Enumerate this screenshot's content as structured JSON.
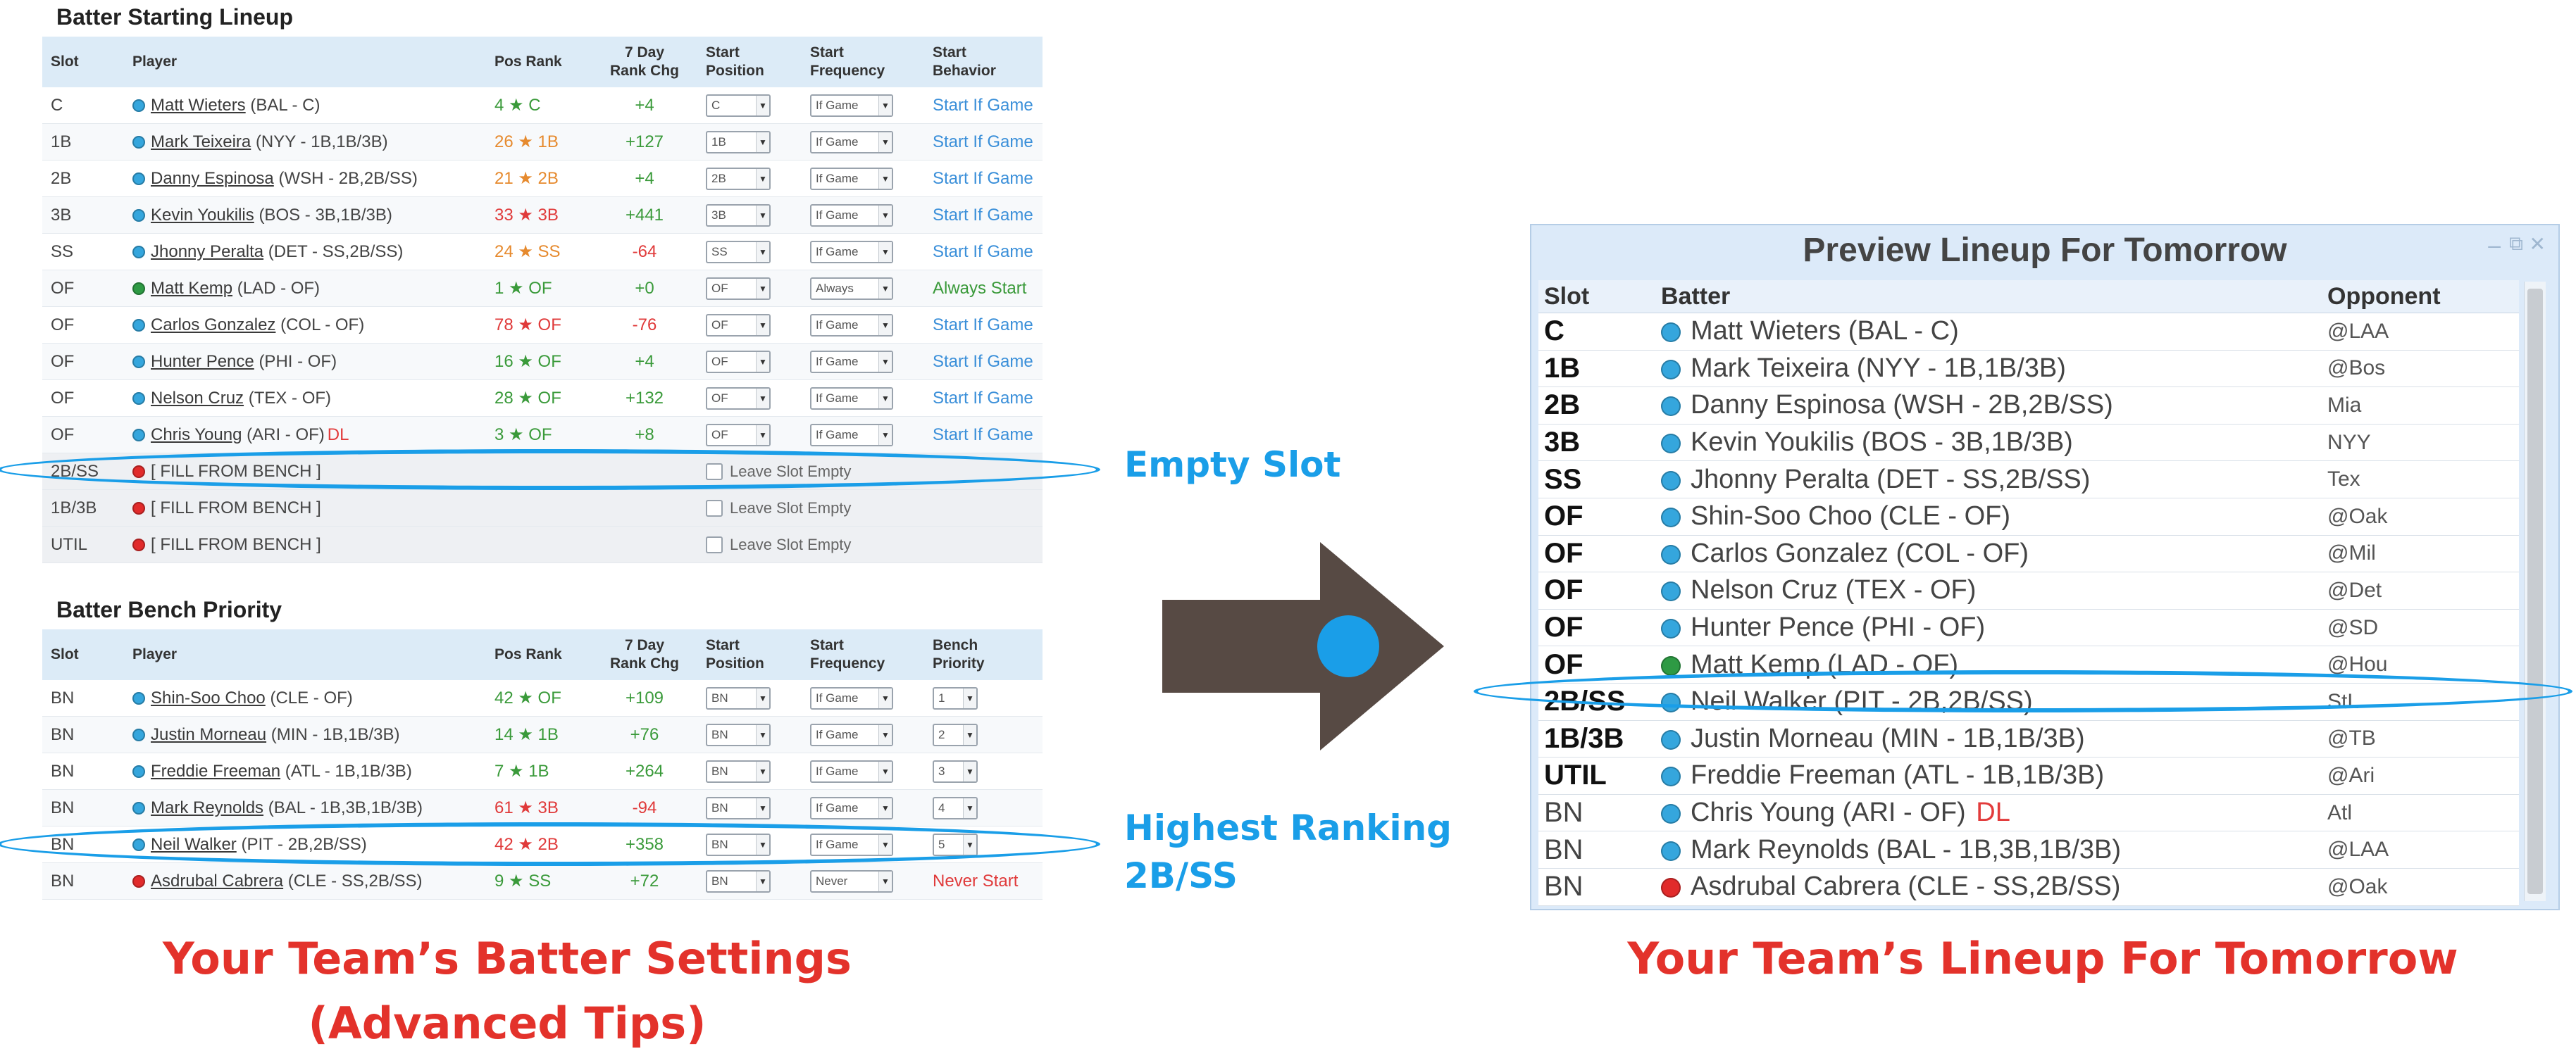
{
  "colors": {
    "accent_blue": "#1a9ee8",
    "caption_red": "#e3322b",
    "arrow": "#574a44",
    "player_blue": "#35a6dd",
    "player_green": "#2e9a44",
    "player_red": "#e12b2b"
  },
  "starting": {
    "title": "Batter Starting Lineup",
    "headers": {
      "slot": "Slot",
      "player": "Player",
      "pos_rank": "Pos Rank",
      "chg_line1": "7 Day",
      "chg_line2": "Rank Chg",
      "pos_line1": "Start",
      "pos_line2": "Position",
      "freq_line1": "Start",
      "freq_line2": "Frequency",
      "beh_line1": "Start",
      "beh_line2": "Behavior"
    },
    "rows": [
      {
        "slot": "C",
        "player": "Matt Wieters",
        "info": "(BAL - C)",
        "dot": "blue",
        "rank": "4 ★ C",
        "rank_color": "#3a9a3a",
        "chg": "+4",
        "chg_color": "#3a9a3a",
        "pos": "C",
        "freq": "If Game",
        "behavior": "Start If Game",
        "behavior_color": "#3a8fd9"
      },
      {
        "slot": "1B",
        "player": "Mark Teixeira",
        "info": "(NYY - 1B,1B/3B)",
        "dot": "blue",
        "rank": "26 ★ 1B",
        "rank_color": "#e68a2e",
        "chg": "+127",
        "chg_color": "#3a9a3a",
        "pos": "1B",
        "freq": "If Game",
        "behavior": "Start If Game",
        "behavior_color": "#3a8fd9"
      },
      {
        "slot": "2B",
        "player": "Danny Espinosa",
        "info": "(WSH - 2B,2B/SS)",
        "dot": "blue",
        "rank": "21 ★ 2B",
        "rank_color": "#e68a2e",
        "chg": "+4",
        "chg_color": "#3a9a3a",
        "pos": "2B",
        "freq": "If Game",
        "behavior": "Start If Game",
        "behavior_color": "#3a8fd9"
      },
      {
        "slot": "3B",
        "player": "Kevin Youkilis",
        "info": "(BOS - 3B,1B/3B)",
        "dot": "blue",
        "rank": "33 ★ 3B",
        "rank_color": "#e03a3a",
        "chg": "+441",
        "chg_color": "#3a9a3a",
        "pos": "3B",
        "freq": "If Game",
        "behavior": "Start If Game",
        "behavior_color": "#3a8fd9"
      },
      {
        "slot": "SS",
        "player": "Jhonny Peralta",
        "info": "(DET - SS,2B/SS)",
        "dot": "blue",
        "rank": "24 ★ SS",
        "rank_color": "#e68a2e",
        "chg": "-64",
        "chg_color": "#e03a3a",
        "pos": "SS",
        "freq": "If Game",
        "behavior": "Start If Game",
        "behavior_color": "#3a8fd9"
      },
      {
        "slot": "OF",
        "player": "Matt Kemp",
        "info": "(LAD - OF)",
        "dot": "green",
        "rank": "1 ★ OF",
        "rank_color": "#3a9a3a",
        "chg": "+0",
        "chg_color": "#3a9a3a",
        "pos": "OF",
        "freq": "Always",
        "behavior": "Always Start",
        "behavior_color": "#3a9a3a"
      },
      {
        "slot": "OF",
        "player": "Carlos Gonzalez",
        "info": "(COL - OF)",
        "dot": "blue",
        "rank": "78 ★ OF",
        "rank_color": "#e03a3a",
        "chg": "-76",
        "chg_color": "#e03a3a",
        "pos": "OF",
        "freq": "If Game",
        "behavior": "Start If Game",
        "behavior_color": "#3a8fd9"
      },
      {
        "slot": "OF",
        "player": "Hunter Pence",
        "info": "(PHI - OF)",
        "dot": "blue",
        "rank": "16 ★ OF",
        "rank_color": "#3a9a3a",
        "chg": "+4",
        "chg_color": "#3a9a3a",
        "pos": "OF",
        "freq": "If Game",
        "behavior": "Start If Game",
        "behavior_color": "#3a8fd9"
      },
      {
        "slot": "OF",
        "player": "Nelson Cruz",
        "info": "(TEX - OF)",
        "dot": "blue",
        "rank": "28 ★ OF",
        "rank_color": "#3a9a3a",
        "chg": "+132",
        "chg_color": "#3a9a3a",
        "pos": "OF",
        "freq": "If Game",
        "behavior": "Start If Game",
        "behavior_color": "#3a8fd9"
      },
      {
        "slot": "OF",
        "player": "Chris Young",
        "info": "(ARI - OF)",
        "dl": "DL",
        "dot": "blue",
        "rank": "3 ★ OF",
        "rank_color": "#3a9a3a",
        "chg": "+8",
        "chg_color": "#3a9a3a",
        "pos": "OF",
        "freq": "If Game",
        "behavior": "Start If Game",
        "behavior_color": "#3a8fd9"
      }
    ],
    "fill_rows": [
      {
        "slot": "2B/SS",
        "text": "[ FILL FROM BENCH ]",
        "leave": "Leave Slot Empty"
      },
      {
        "slot": "1B/3B",
        "text": "[ FILL FROM BENCH ]",
        "leave": "Leave Slot Empty"
      },
      {
        "slot": "UTIL",
        "text": "[ FILL FROM BENCH ]",
        "leave": "Leave Slot Empty"
      }
    ]
  },
  "bench": {
    "title": "Batter Bench Priority",
    "headers": {
      "slot": "Slot",
      "player": "Player",
      "pos_rank": "Pos Rank",
      "chg_line1": "7 Day",
      "chg_line2": "Rank Chg",
      "pos_line1": "Start",
      "pos_line2": "Position",
      "freq_line1": "Start",
      "freq_line2": "Frequency",
      "pri_line1": "Bench",
      "pri_line2": "Priority"
    },
    "rows": [
      {
        "slot": "BN",
        "player": "Shin-Soo Choo",
        "info": "(CLE - OF)",
        "dot": "blue",
        "rank": "42 ★ OF",
        "rank_color": "#3a9a3a",
        "chg": "+109",
        "chg_color": "#3a9a3a",
        "pos": "BN",
        "freq": "If Game",
        "priority": "1"
      },
      {
        "slot": "BN",
        "player": "Justin Morneau",
        "info": "(MIN - 1B,1B/3B)",
        "dot": "blue",
        "rank": "14 ★ 1B",
        "rank_color": "#3a9a3a",
        "chg": "+76",
        "chg_color": "#3a9a3a",
        "pos": "BN",
        "freq": "If Game",
        "priority": "2"
      },
      {
        "slot": "BN",
        "player": "Freddie Freeman",
        "info": "(ATL - 1B,1B/3B)",
        "dot": "blue",
        "rank": "7 ★ 1B",
        "rank_color": "#3a9a3a",
        "chg": "+264",
        "chg_color": "#3a9a3a",
        "pos": "BN",
        "freq": "If Game",
        "priority": "3"
      },
      {
        "slot": "BN",
        "player": "Mark Reynolds",
        "info": "(BAL - 1B,3B,1B/3B)",
        "dot": "blue",
        "rank": "61 ★ 3B",
        "rank_color": "#e03a3a",
        "chg": "-94",
        "chg_color": "#e03a3a",
        "pos": "BN",
        "freq": "If Game",
        "priority": "4"
      },
      {
        "slot": "BN",
        "player": "Neil Walker",
        "info": "(PIT - 2B,2B/SS)",
        "dot": "blue",
        "rank": "42 ★ 2B",
        "rank_color": "#e03a3a",
        "chg": "+358",
        "chg_color": "#3a9a3a",
        "pos": "BN",
        "freq": "If Game",
        "priority": "5"
      },
      {
        "slot": "BN",
        "player": "Asdrubal Cabrera",
        "info": "(CLE - SS,2B/SS)",
        "dot": "red",
        "rank": "9 ★ SS",
        "rank_color": "#3a9a3a",
        "chg": "+72",
        "chg_color": "#3a9a3a",
        "pos": "BN",
        "freq": "Never",
        "priority": "",
        "behavior": "Never Start",
        "behavior_color": "#e03a3a"
      }
    ]
  },
  "callouts": {
    "empty_slot": "Empty Slot",
    "highest_line1": "Highest Ranking",
    "highest_line2": "2B/SS"
  },
  "captions": {
    "left_line1": "Your Team’s Batter Settings",
    "left_line2": "(Advanced Tips)",
    "right": "Your Team’s Lineup For Tomorrow"
  },
  "preview": {
    "title": "Preview Lineup For Tomorrow",
    "controls": {
      "minimize": "–",
      "restore": "⧉",
      "close": "✕"
    },
    "headers": {
      "slot": "Slot",
      "batter": "Batter",
      "opponent": "Opponent"
    },
    "rows": [
      {
        "slot": "C",
        "batter": "Matt Wieters (BAL - C)",
        "opp": "@LAA",
        "dot": "blue"
      },
      {
        "slot": "1B",
        "batter": "Mark Teixeira (NYY - 1B,1B/3B)",
        "opp": "@Bos",
        "dot": "blue"
      },
      {
        "slot": "2B",
        "batter": "Danny Espinosa (WSH - 2B,2B/SS)",
        "opp": "Mia",
        "dot": "blue"
      },
      {
        "slot": "3B",
        "batter": "Kevin Youkilis (BOS - 3B,1B/3B)",
        "opp": "NYY",
        "dot": "blue"
      },
      {
        "slot": "SS",
        "batter": "Jhonny Peralta (DET - SS,2B/SS)",
        "opp": "Tex",
        "dot": "blue"
      },
      {
        "slot": "OF",
        "batter": "Shin-Soo Choo (CLE - OF)",
        "opp": "@Oak",
        "dot": "blue"
      },
      {
        "slot": "OF",
        "batter": "Carlos Gonzalez (COL - OF)",
        "opp": "@Mil",
        "dot": "blue"
      },
      {
        "slot": "OF",
        "batter": "Nelson Cruz (TEX - OF)",
        "opp": "@Det",
        "dot": "blue"
      },
      {
        "slot": "OF",
        "batter": "Hunter Pence (PHI - OF)",
        "opp": "@SD",
        "dot": "blue"
      },
      {
        "slot": "OF",
        "batter": "Matt Kemp (LAD - OF)",
        "opp": "@Hou",
        "dot": "green"
      },
      {
        "slot": "2B/SS",
        "batter": "Neil Walker (PIT - 2B,2B/SS)",
        "opp": "StL",
        "dot": "blue"
      },
      {
        "slot": "1B/3B",
        "batter": "Justin Morneau (MIN - 1B,1B/3B)",
        "opp": "@TB",
        "dot": "blue"
      },
      {
        "slot": "UTIL",
        "batter": "Freddie Freeman (ATL - 1B,1B/3B)",
        "opp": "@Ari",
        "dot": "blue"
      },
      {
        "slot": "BN",
        "batter": "Chris Young (ARI - OF)",
        "dl": "DL",
        "opp": "Atl",
        "dot": "blue"
      },
      {
        "slot": "BN",
        "batter": "Mark Reynolds (BAL - 1B,3B,1B/3B)",
        "opp": "@LAA",
        "dot": "blue"
      },
      {
        "slot": "BN",
        "batter": "Asdrubal Cabrera (CLE - SS,2B/SS)",
        "opp": "@Oak",
        "dot": "red"
      }
    ]
  }
}
